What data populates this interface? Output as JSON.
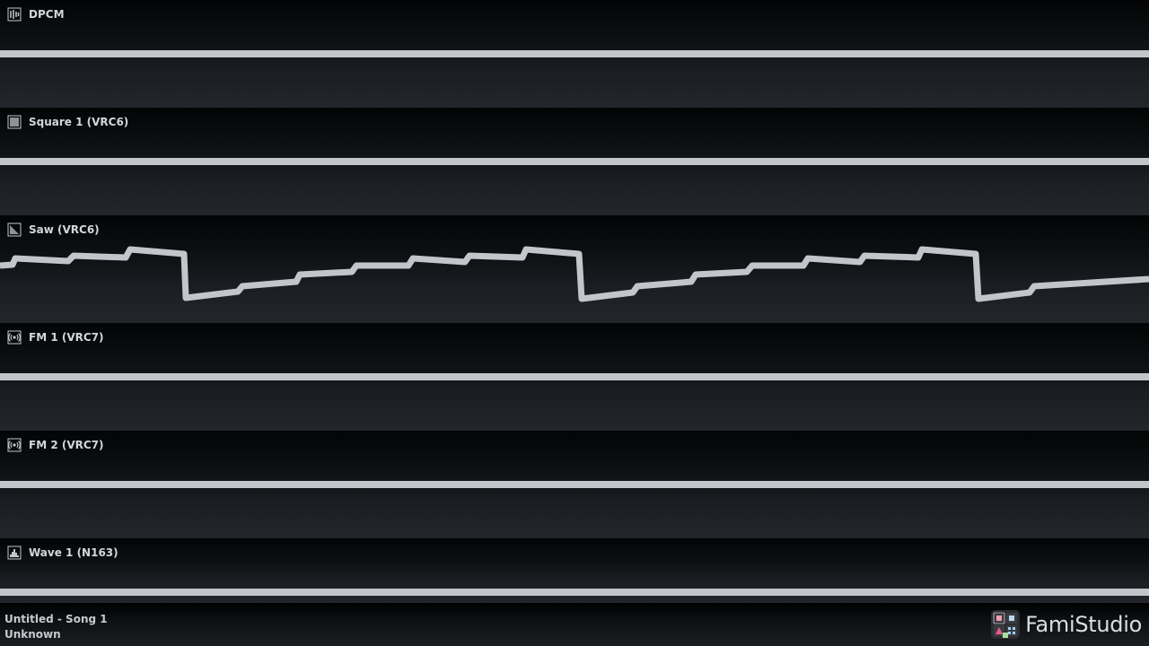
{
  "channels": [
    {
      "name": "DPCM",
      "icon": "dpcm-icon",
      "waveform": "flat"
    },
    {
      "name": "Square 1 (VRC6)",
      "icon": "square-icon",
      "waveform": "flat"
    },
    {
      "name": "Saw (VRC6)",
      "icon": "saw-icon",
      "waveform": "saw"
    },
    {
      "name": "FM 1 (VRC7)",
      "icon": "fm-icon",
      "waveform": "flat"
    },
    {
      "name": "FM 2 (VRC7)",
      "icon": "fm-icon",
      "waveform": "flat"
    },
    {
      "name": "Wave 1 (N163)",
      "icon": "wave-icon",
      "waveform": "flat"
    }
  ],
  "footer": {
    "song_title": "Untitled - Song 1",
    "author": "Unknown",
    "brand": "FamiStudio"
  },
  "colors": {
    "waveform": "#c3c5ca",
    "text": "#d4d6db"
  }
}
